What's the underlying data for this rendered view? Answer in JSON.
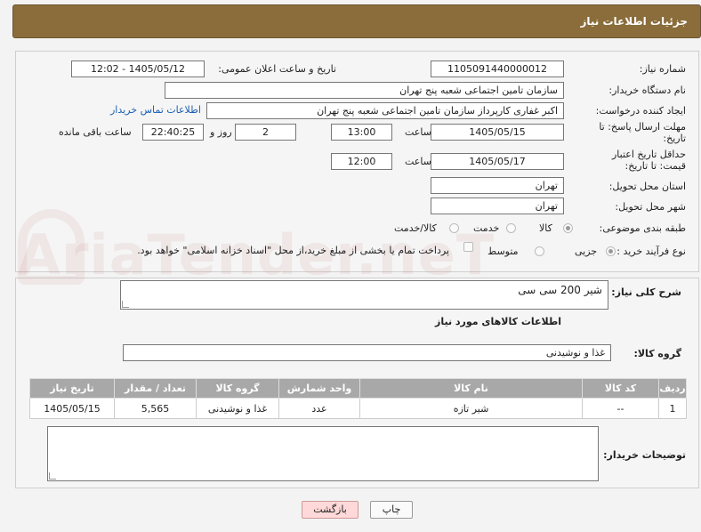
{
  "header": {
    "title": "جزئیات اطلاعات نیاز"
  },
  "form": {
    "need_number_label": "شماره نیاز:",
    "need_number": "1105091440000012",
    "announce_label": "تاریخ و ساعت اعلان عمومی:",
    "announce_value": "1405/05/12 - 12:02",
    "buyer_org_label": "نام دستگاه خریدار:",
    "buyer_org": "سازمان تامین اجتماعی شعبه پنج تهران",
    "creator_label": "ایجاد کننده درخواست:",
    "creator": "اکبر غفاری کارپرداز  سازمان تامین اجتماعی شعبه پنج تهران",
    "contact_link": "اطلاعات تماس خریدار",
    "reply_deadline_label": "مهلت ارسال پاسخ: تا تاریخ:",
    "reply_date": "1405/05/15",
    "time_label": "ساعت",
    "reply_time": "13:00",
    "days_value": "2",
    "days_label": "روز و",
    "remaining_time": "22:40:25",
    "remaining_label": "ساعت باقی مانده",
    "price_deadline_label": "حداقل تاریخ اعتبار قیمت: تا تاریخ:",
    "price_date": "1405/05/17",
    "price_time": "12:00",
    "province_label": "استان محل تحویل:",
    "province": "تهران",
    "city_label": "شهر محل تحویل:",
    "city": "تهران",
    "category_label": "طبقه بندی موضوعی:",
    "category_options": [
      "کالا",
      "خدمت",
      "کالا/خدمت"
    ],
    "process_label": "نوع فرآیند خرید :",
    "process_options": [
      "جزیی",
      "متوسط"
    ],
    "payment_note": "پرداخت تمام یا بخشی از مبلغ خرید،از محل \"اسناد خزانه اسلامی\" خواهد بود."
  },
  "general": {
    "summary_label": "شرح کلی نیاز:",
    "summary_value": "شیر 200 سی سی",
    "goods_info_title": "اطلاعات کالاهای مورد نیاز",
    "group_label": "گروه کالا:",
    "group_value": "غذا و نوشیدنی"
  },
  "table": {
    "headers": [
      "ردیف",
      "کد کالا",
      "نام کالا",
      "واحد شمارش",
      "گروه کالا",
      "تعداد / مقدار",
      "تاریخ نیاز"
    ],
    "rows": [
      [
        "1",
        "--",
        "شیر تازه",
        "عدد",
        "غذا و نوشیدنی",
        "5,565",
        "1405/05/15"
      ]
    ]
  },
  "buyer_notes_label": "توضیحات خریدار:",
  "buttons": {
    "print": "چاپ",
    "back": "بازگشت"
  },
  "watermark": "AriaTender.neT"
}
